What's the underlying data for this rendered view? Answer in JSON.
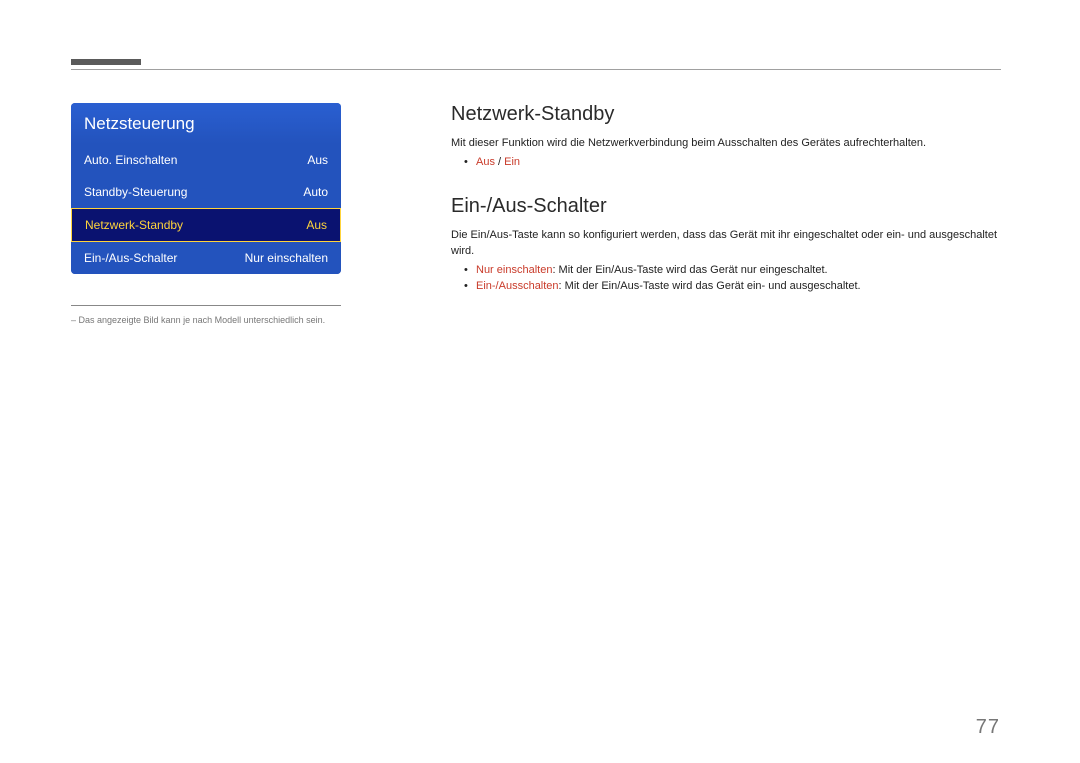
{
  "menu": {
    "title": "Netzsteuerung",
    "items": [
      {
        "label": "Auto. Einschalten",
        "value": "Aus",
        "selected": false
      },
      {
        "label": "Standby-Steuerung",
        "value": "Auto",
        "selected": false
      },
      {
        "label": "Netzwerk-Standby",
        "value": "Aus",
        "selected": true
      },
      {
        "label": "Ein-/Aus-Schalter",
        "value": "Nur einschalten",
        "selected": false
      }
    ]
  },
  "footnote": "–  Das angezeigte Bild kann je nach Modell unterschiedlich sein.",
  "section1": {
    "heading": "Netzwerk-Standby",
    "intro": "Mit dieser Funktion wird die Netzwerkverbindung beim Ausschalten des Gerätes aufrechterhalten.",
    "options": {
      "a": "Aus",
      "sep": " / ",
      "b": "Ein"
    }
  },
  "section2": {
    "heading": "Ein-/Aus-Schalter",
    "intro": "Die Ein/Aus-Taste kann so konfiguriert werden, dass das Gerät mit ihr eingeschaltet oder ein- und ausgeschaltet wird.",
    "bullets": [
      {
        "term": "Nur einschalten",
        "desc": ": Mit der Ein/Aus-Taste wird das Gerät nur eingeschaltet."
      },
      {
        "term": "Ein-/Ausschalten",
        "desc": ": Mit der Ein/Aus-Taste wird das Gerät ein- und ausgeschaltet."
      }
    ]
  },
  "page_number": "77"
}
